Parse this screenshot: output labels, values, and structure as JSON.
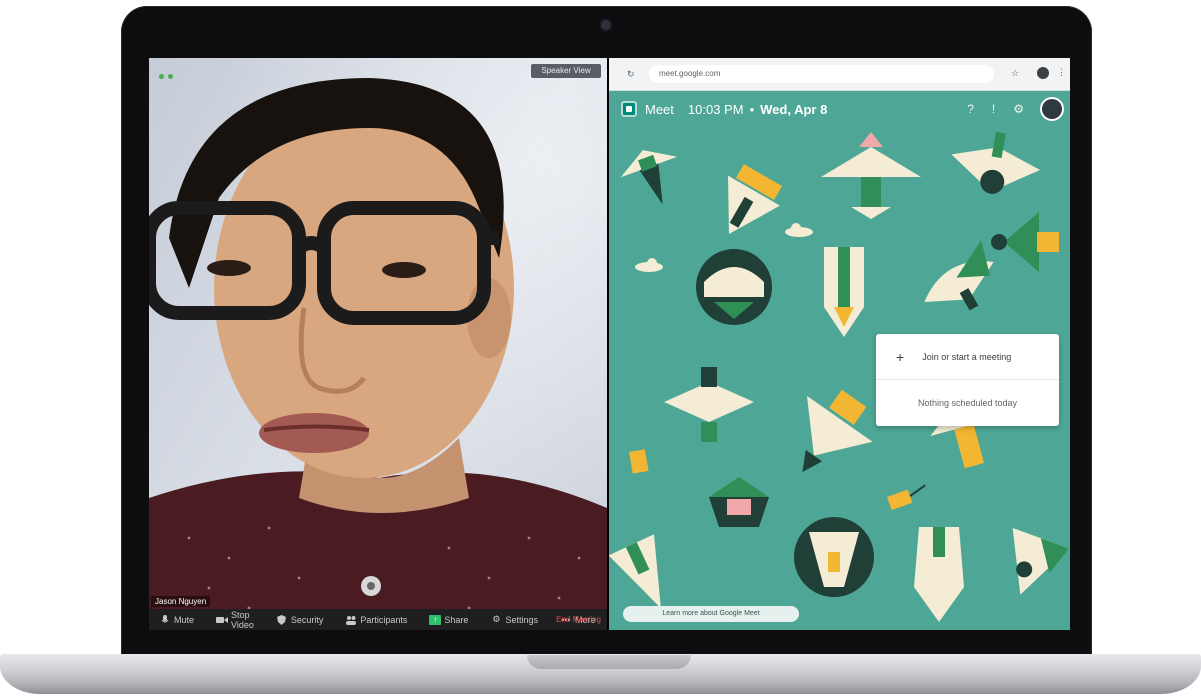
{
  "zoom": {
    "view_label": "Speaker View",
    "participant_name": "Jason Nguyen",
    "toolbar": [
      {
        "label": "Mute",
        "icon": "microphone-icon"
      },
      {
        "label": "Stop Video",
        "icon": "video-camera-icon"
      },
      {
        "label": "Security",
        "icon": "shield-icon"
      },
      {
        "label": "Participants",
        "icon": "participants-icon"
      },
      {
        "label": "Share",
        "icon": "share-screen-icon"
      },
      {
        "label": "Settings",
        "icon": "gear-icon"
      },
      {
        "label": "More",
        "icon": "more-icon"
      }
    ],
    "end_label": "End Meeting"
  },
  "browser": {
    "url": "meet.google.com",
    "meet": {
      "app_name": "Meet",
      "time": "10:03 PM",
      "separator": "•",
      "date": "Wed, Apr 8",
      "menu": {
        "join_label": "Join or start a meeting",
        "empty_label": "Nothing scheduled today"
      },
      "footer_text": "Learn more about Google Meet"
    }
  },
  "colors": {
    "meet_background": "#4ea796",
    "zoom_share_green": "#2ec06c",
    "zoom_end_red": "#e04848",
    "bird_cream": "#f4ecd4",
    "bird_yellow": "#f2b632",
    "bird_dark": "#1f3f37",
    "bird_green": "#2f8f56",
    "bird_pink": "#f0a8a8"
  }
}
